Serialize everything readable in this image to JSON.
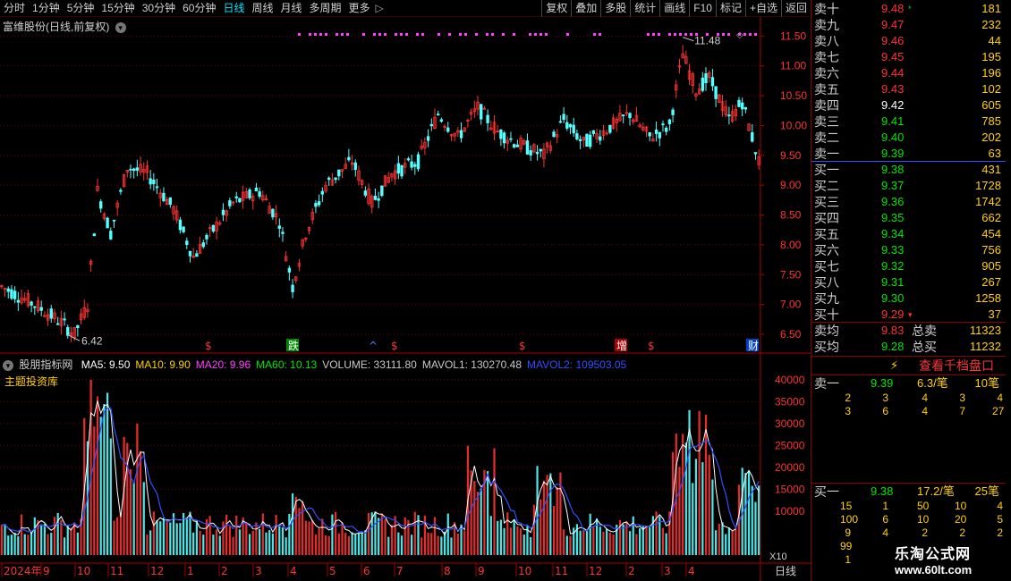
{
  "toolbar": {
    "periods": [
      "分时",
      "1分钟",
      "5分钟",
      "15分钟",
      "30分钟",
      "60分钟",
      "日线",
      "周线",
      "月线",
      "多周期",
      "更多"
    ],
    "active_index": 6,
    "more_arrow": "▷",
    "buttons": [
      "复权",
      "叠加",
      "多股",
      "统计",
      "画线",
      "F10",
      "标记",
      "+自选",
      "返回"
    ]
  },
  "main_chart": {
    "title": "富维股份(日线,前复权)",
    "title_icon": "chevron-down-icon",
    "price_axis": [
      "11.50",
      "11.00",
      "10.50",
      "10.00",
      "9.50",
      "9.00",
      "8.50",
      "8.00",
      "7.50",
      "7.00",
      "6.50"
    ],
    "high_label": "11.48",
    "low_label": "6.42",
    "markers": [
      {
        "text": "$",
        "color": "#ff3232"
      },
      {
        "text": "跌",
        "color": "#ffffff",
        "bg": "#008800"
      },
      {
        "text": "^",
        "color": "#5080ff"
      },
      {
        "text": "$",
        "color": "#ff3232"
      },
      {
        "text": "$",
        "color": "#ff3232"
      },
      {
        "text": "增",
        "color": "#ffffff",
        "bg": "#aa0000"
      },
      {
        "text": "$",
        "color": "#ff3232"
      },
      {
        "text": "财",
        "color": "#ffffff",
        "bg": "#0044cc"
      }
    ]
  },
  "indicator": {
    "name": "股朋指标网",
    "name_icon": "chevron-down-icon",
    "sub_label": "主题投资库",
    "values": [
      {
        "label": "MA5: 9.50",
        "color": "#ffffff"
      },
      {
        "label": "MA10: 9.90",
        "color": "#ffd200"
      },
      {
        "label": "MA20: 9.96",
        "color": "#ff40ff"
      },
      {
        "label": "MA60: 10.13",
        "color": "#00e600"
      },
      {
        "label": "VOLUME: 33111.80",
        "color": "#c8c8c8"
      },
      {
        "label": "MAVOL1: 130270.48",
        "color": "#c8c8c8"
      },
      {
        "label": "MAVOL2: 109503.05",
        "color": "#3050ff"
      }
    ],
    "vol_axis": [
      "40000",
      "35000",
      "30000",
      "25000",
      "20000",
      "15000",
      "10000"
    ],
    "multiplier": "X10"
  },
  "time_axis": {
    "labels": [
      "2024年",
      "9",
      "10",
      "11",
      "12",
      "1",
      "2",
      "3",
      "4",
      "5",
      "6",
      "7",
      "8",
      "9",
      "10",
      "11",
      "12",
      "2",
      "3",
      "4"
    ],
    "period_label": "日线"
  },
  "order_book": {
    "asks": [
      {
        "label": "卖十",
        "price": "9.48",
        "vol": "181",
        "mark": "*"
      },
      {
        "label": "卖九",
        "price": "9.47",
        "vol": "232"
      },
      {
        "label": "卖八",
        "price": "9.46",
        "vol": "44"
      },
      {
        "label": "卖七",
        "price": "9.45",
        "vol": "195"
      },
      {
        "label": "卖六",
        "price": "9.44",
        "vol": "196"
      },
      {
        "label": "卖五",
        "price": "9.43",
        "vol": "102"
      },
      {
        "label": "卖四",
        "price": "9.42",
        "vol": "605"
      },
      {
        "label": "卖三",
        "price": "9.41",
        "vol": "785"
      },
      {
        "label": "卖二",
        "price": "9.40",
        "vol": "202"
      },
      {
        "label": "卖一",
        "price": "9.39",
        "vol": "63"
      }
    ],
    "bids": [
      {
        "label": "买一",
        "price": "9.38",
        "vol": "431"
      },
      {
        "label": "买二",
        "price": "9.37",
        "vol": "1728"
      },
      {
        "label": "买三",
        "price": "9.36",
        "vol": "1742"
      },
      {
        "label": "买四",
        "price": "9.35",
        "vol": "662"
      },
      {
        "label": "买五",
        "price": "9.34",
        "vol": "454"
      },
      {
        "label": "买六",
        "price": "9.33",
        "vol": "756"
      },
      {
        "label": "买七",
        "price": "9.32",
        "vol": "905"
      },
      {
        "label": "买八",
        "price": "9.31",
        "vol": "267"
      },
      {
        "label": "买九",
        "price": "9.30",
        "vol": "1258"
      },
      {
        "label": "买十",
        "price": "9.29",
        "vol": "37",
        "mark": "▾"
      }
    ],
    "avg_ask": {
      "label": "卖均",
      "price": "9.83",
      "total_label": "总卖",
      "total": "11323"
    },
    "avg_bid": {
      "label": "买均",
      "price": "9.28",
      "total_label": "总买",
      "total": "11232"
    },
    "level1000_icon": "lightning-icon",
    "level1000_label": "查看千档盘口",
    "ask_queue": {
      "label": "卖一",
      "price": "9.39",
      "avg": "6.3/笔",
      "count": "10笔",
      "rows": [
        [
          "2",
          "3",
          "4",
          "3",
          "4"
        ],
        [
          "3",
          "6",
          "4",
          "7",
          "27"
        ]
      ]
    },
    "bid_queue": {
      "label": "买一",
      "price": "9.38",
      "avg": "17.2/笔",
      "count": "25笔",
      "rows": [
        [
          "15",
          "1",
          "50",
          "10",
          "4"
        ],
        [
          "100",
          "6",
          "10",
          "20",
          "5"
        ],
        [
          "9",
          "4",
          "2",
          "2",
          "2"
        ],
        [
          "99",
          "1",
          "",
          "",
          ""
        ],
        [
          "1",
          "",
          "",
          "",
          ""
        ]
      ]
    }
  },
  "watermark": {
    "title": "乐淘公式网",
    "url": "www.60lt.com"
  },
  "colors": {
    "up": "#ff3232",
    "down": "#54ffff",
    "grid": "#6e0000",
    "axis_text": "#ff3232",
    "mavol1": "#ffffff",
    "mavol2": "#3050ff"
  }
}
